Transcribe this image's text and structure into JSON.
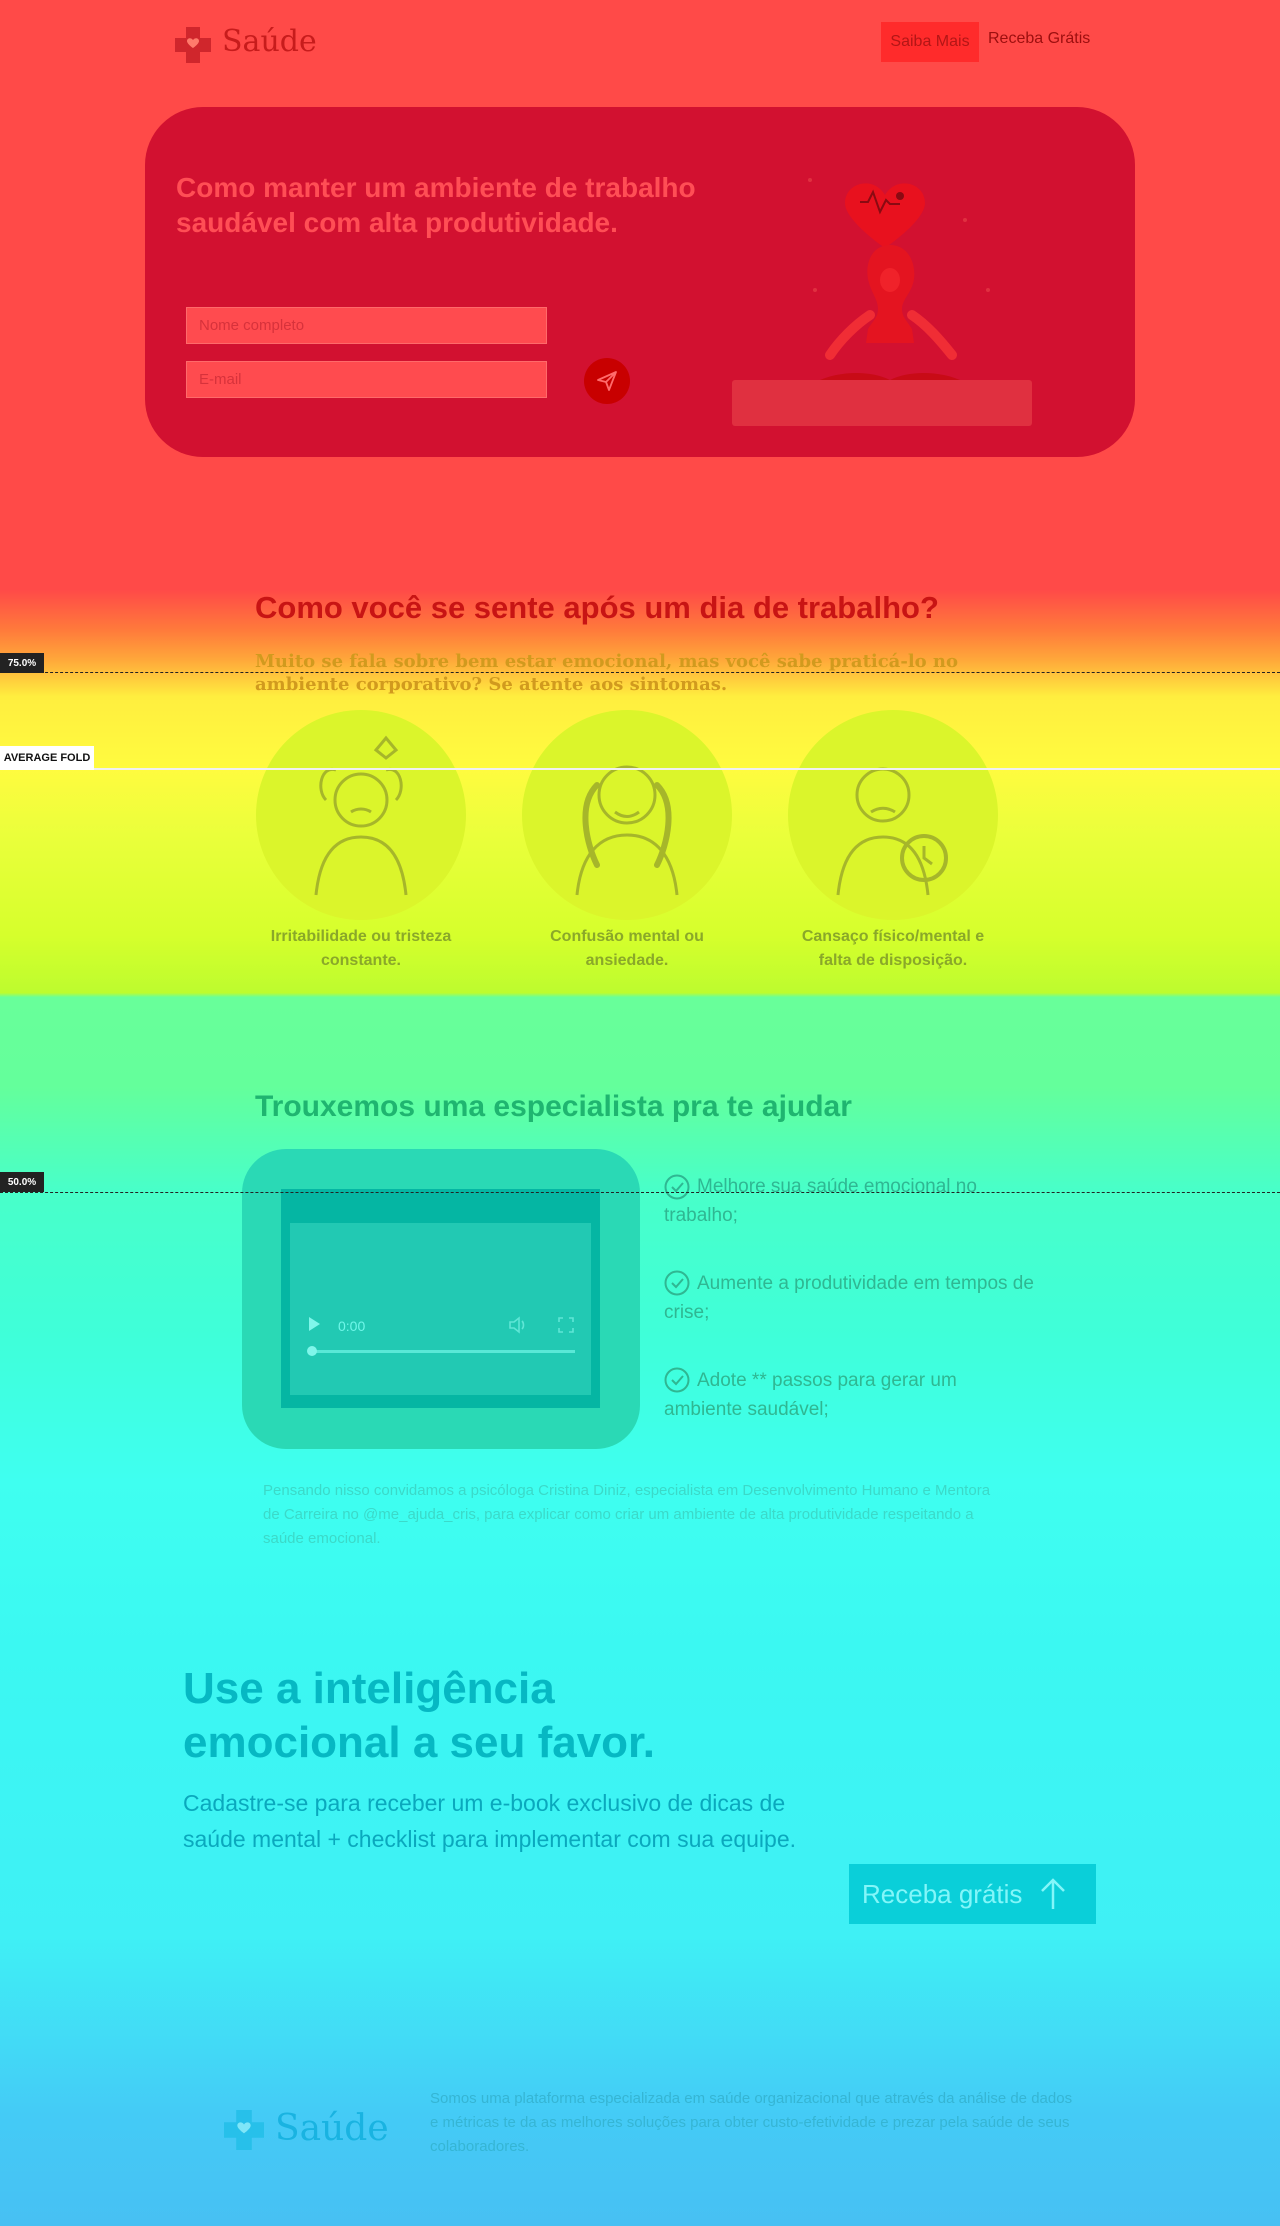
{
  "header": {
    "logo_text": "Saúde",
    "nav": [
      {
        "label": "Saiba Mais"
      },
      {
        "label": "Receba Grátis"
      }
    ]
  },
  "hero": {
    "title": "Como manter um ambiente de trabalho saudável com alta produtividade.",
    "name_placeholder": "Nome completo",
    "email_placeholder": "E-mail",
    "send_icon": "paper-plane-icon",
    "illustration": "meditating-woman-with-heart-icon"
  },
  "symptoms": {
    "title": "Como você se sente após um dia de trabalho?",
    "subtitle": "Muito se fala sobre bem estar emocional, mas você sabe praticá-lo no ambiente corporativo? Se atente aos sintomas.",
    "items": [
      {
        "label": "Irritabilidade ou tristeza constante."
      },
      {
        "label": "Confusão mental ou ansiedade."
      },
      {
        "label": "Cansaço físico/mental e falta de disposição."
      }
    ]
  },
  "specialist": {
    "title": "Trouxemos uma especialista pra te ajudar",
    "video_time": "0:00",
    "benefits": [
      "Melhore sua saúde emocional no trabalho;",
      "Aumente a produtividade em tempos de crise;",
      "Adote ** passos para gerar um ambiente saudável;"
    ],
    "paragraph": "Pensando nisso convidamos a psicóloga Cristina Diniz, especialista em Desenvolvimento Humano e Mentora de Carreira no @me_ajuda_cris, para explicar como criar um ambiente de alta produtividade respeitando a saúde emocional."
  },
  "cta_section": {
    "title": "Use a inteligência emocional a seu favor.",
    "text": "Cadastre-se para receber um e-book exclusivo de dicas de saúde mental + checklist para implementar com sua equipe.",
    "button_label": "Receba grátis"
  },
  "footer": {
    "logo_text": "Saúde",
    "text": "Somos uma plataforma especializada em saúde organizacional que através da análise de dados e métricas te da as melhores soluções para obter custo-efetividade e prezar pela saúde de seus colaboradores."
  },
  "overlay": {
    "marker_75": "75.0%",
    "fold_label": "AVERAGE FOLD",
    "marker_50": "50.0%"
  }
}
